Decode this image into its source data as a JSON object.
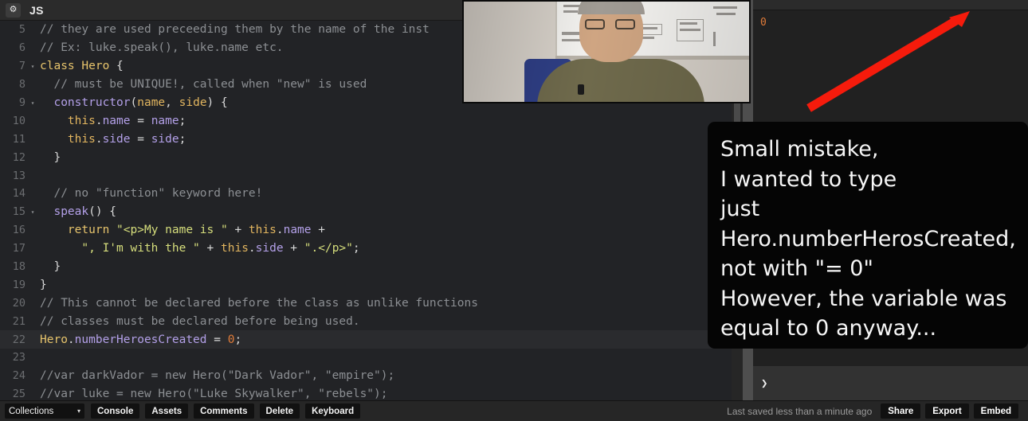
{
  "editor": {
    "gear_icon": "gear-icon",
    "language_label": "JS",
    "lines": [
      {
        "num": "5",
        "fold": "",
        "tokens": [
          {
            "c": "t-com",
            "t": "// they are used preceeding them by the name of the inst"
          }
        ]
      },
      {
        "num": "6",
        "fold": "",
        "tokens": [
          {
            "c": "t-com",
            "t": "// Ex: luke.speak(), luke.name etc."
          }
        ]
      },
      {
        "num": "7",
        "fold": "▾",
        "tokens": [
          {
            "c": "t-kw",
            "t": "class"
          },
          {
            "c": "t-pun",
            "t": " "
          },
          {
            "c": "t-cls",
            "t": "Hero"
          },
          {
            "c": "t-pun",
            "t": " {"
          }
        ]
      },
      {
        "num": "8",
        "fold": "",
        "tokens": [
          {
            "c": "t-com",
            "t": "  // must be UNIQUE!, called when \"new\" is used"
          }
        ]
      },
      {
        "num": "9",
        "fold": "▾",
        "tokens": [
          {
            "c": "t-fn",
            "t": "  constructor"
          },
          {
            "c": "t-pun",
            "t": "("
          },
          {
            "c": "t-par",
            "t": "name"
          },
          {
            "c": "t-pun",
            "t": ", "
          },
          {
            "c": "t-par",
            "t": "side"
          },
          {
            "c": "t-pun",
            "t": ") {"
          }
        ]
      },
      {
        "num": "10",
        "fold": "",
        "tokens": [
          {
            "c": "t-this",
            "t": "    this"
          },
          {
            "c": "t-pun",
            "t": "."
          },
          {
            "c": "t-prop",
            "t": "name"
          },
          {
            "c": "t-op",
            "t": " = "
          },
          {
            "c": "t-var",
            "t": "name"
          },
          {
            "c": "t-pun",
            "t": ";"
          }
        ]
      },
      {
        "num": "11",
        "fold": "",
        "tokens": [
          {
            "c": "t-this",
            "t": "    this"
          },
          {
            "c": "t-pun",
            "t": "."
          },
          {
            "c": "t-prop",
            "t": "side"
          },
          {
            "c": "t-op",
            "t": " = "
          },
          {
            "c": "t-var",
            "t": "side"
          },
          {
            "c": "t-pun",
            "t": ";"
          }
        ]
      },
      {
        "num": "12",
        "fold": "",
        "tokens": [
          {
            "c": "t-pun",
            "t": "  }"
          }
        ]
      },
      {
        "num": "13",
        "fold": "",
        "tokens": [
          {
            "c": "t-pun",
            "t": ""
          }
        ]
      },
      {
        "num": "14",
        "fold": "",
        "tokens": [
          {
            "c": "t-com",
            "t": "  // no \"function\" keyword here!"
          }
        ]
      },
      {
        "num": "15",
        "fold": "▾",
        "tokens": [
          {
            "c": "t-fn",
            "t": "  speak"
          },
          {
            "c": "t-pun",
            "t": "() {"
          }
        ]
      },
      {
        "num": "16",
        "fold": "",
        "tokens": [
          {
            "c": "t-kw",
            "t": "    return"
          },
          {
            "c": "t-pun",
            "t": " "
          },
          {
            "c": "t-str",
            "t": "\"<p>My name is \""
          },
          {
            "c": "t-op",
            "t": " + "
          },
          {
            "c": "t-this",
            "t": "this"
          },
          {
            "c": "t-pun",
            "t": "."
          },
          {
            "c": "t-prop",
            "t": "name"
          },
          {
            "c": "t-op",
            "t": " +"
          }
        ]
      },
      {
        "num": "17",
        "fold": "",
        "tokens": [
          {
            "c": "t-str",
            "t": "      \", I'm with the \""
          },
          {
            "c": "t-op",
            "t": " + "
          },
          {
            "c": "t-this",
            "t": "this"
          },
          {
            "c": "t-pun",
            "t": "."
          },
          {
            "c": "t-prop",
            "t": "side"
          },
          {
            "c": "t-op",
            "t": " + "
          },
          {
            "c": "t-str",
            "t": "\".</p>\""
          },
          {
            "c": "t-pun",
            "t": ";"
          }
        ]
      },
      {
        "num": "18",
        "fold": "",
        "tokens": [
          {
            "c": "t-pun",
            "t": "  }"
          }
        ]
      },
      {
        "num": "19",
        "fold": "",
        "tokens": [
          {
            "c": "t-pun",
            "t": "}"
          }
        ]
      },
      {
        "num": "20",
        "fold": "",
        "tokens": [
          {
            "c": "t-com",
            "t": "// This cannot be declared before the class as unlike functions"
          }
        ]
      },
      {
        "num": "21",
        "fold": "",
        "tokens": [
          {
            "c": "t-com",
            "t": "// classes must be declared before being used."
          }
        ]
      },
      {
        "num": "22",
        "fold": "",
        "active": true,
        "tokens": [
          {
            "c": "t-cls",
            "t": "Hero"
          },
          {
            "c": "t-pun",
            "t": "."
          },
          {
            "c": "t-prop",
            "t": "numberHeroesCreated"
          },
          {
            "c": "t-op",
            "t": " = "
          },
          {
            "c": "t-num",
            "t": "0"
          },
          {
            "c": "t-pun",
            "t": ";"
          }
        ]
      },
      {
        "num": "23",
        "fold": "",
        "tokens": [
          {
            "c": "t-pun",
            "t": ""
          }
        ]
      },
      {
        "num": "24",
        "fold": "",
        "tokens": [
          {
            "c": "t-com",
            "t": "//var darkVador = new Hero(\"Dark Vador\", \"empire\");"
          }
        ]
      },
      {
        "num": "25",
        "fold": "",
        "tokens": [
          {
            "c": "t-com",
            "t": "//var luke = new Hero(\"Luke Skywalker\", \"rebels\");"
          }
        ]
      }
    ]
  },
  "console": {
    "output_value": "0",
    "prompt_caret": "❯",
    "prompt_placeholder": ""
  },
  "annotation": {
    "lines": [
      "Small mistake,",
      "I wanted to type",
      "just",
      "Hero.numberHerosCreated,",
      "not with \"= 0\"",
      "However, the variable was",
      "equal to 0 anyway..."
    ]
  },
  "arrow": {
    "name": "red-arrow-annotation",
    "color": "#f51b0c"
  },
  "webcam": {
    "name": "presenter-webcam-overlay"
  },
  "bottombar": {
    "collections_label": "Collections",
    "collections_caret": "▾",
    "buttons": [
      "Console",
      "Assets",
      "Comments",
      "Delete",
      "Keyboard"
    ],
    "saved_text": "Last saved less than a minute ago",
    "right_buttons": [
      "Share",
      "Export",
      "Embed"
    ]
  }
}
